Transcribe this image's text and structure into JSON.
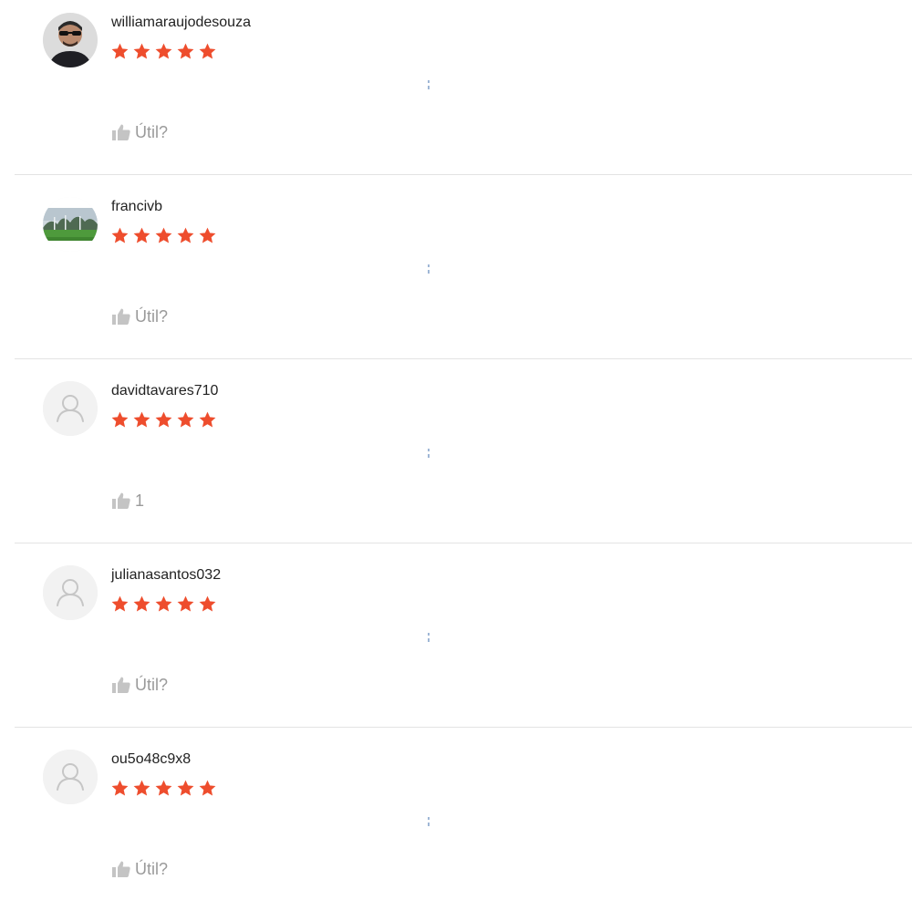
{
  "colors": {
    "star": "#ee4d2d",
    "helpful_text": "#9a9a9a",
    "divider": "#e3e3e3"
  },
  "reviews": [
    {
      "username": "williamaraujodesouza",
      "rating": 5,
      "avatar": "photo-man-sunglasses",
      "helpful_label": "Útil?"
    },
    {
      "username": "francivb",
      "rating": 5,
      "avatar": "photo-landscape-trees",
      "helpful_label": "Útil?"
    },
    {
      "username": "davidtavares710",
      "rating": 5,
      "avatar": "default-user-icon",
      "helpful_label": "1"
    },
    {
      "username": "julianasantos032",
      "rating": 5,
      "avatar": "default-user-icon",
      "helpful_label": "Útil?"
    },
    {
      "username": "ou5o48c9x8",
      "rating": 5,
      "avatar": "default-user-icon",
      "helpful_label": "Útil?"
    }
  ]
}
